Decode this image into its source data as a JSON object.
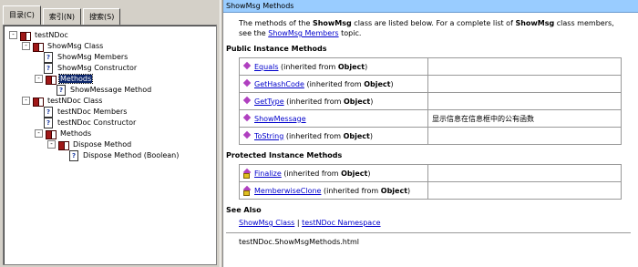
{
  "tabs": [
    "目录(C)",
    "索引(N)",
    "搜索(S)"
  ],
  "tree": [
    {
      "label": "testNDoc",
      "icon": "book",
      "exp": "-",
      "indent": 0
    },
    {
      "label": "ShowMsg Class",
      "icon": "book",
      "exp": "-",
      "indent": 1
    },
    {
      "label": "ShowMsg Members",
      "icon": "page",
      "exp": "",
      "indent": 2
    },
    {
      "label": "ShowMsg Constructor",
      "icon": "page",
      "exp": "",
      "indent": 2
    },
    {
      "label": "Methods",
      "icon": "book",
      "exp": "-",
      "indent": 2,
      "selected": true
    },
    {
      "label": "ShowMessage Method",
      "icon": "page",
      "exp": "",
      "indent": 3
    },
    {
      "label": "testNDoc Class",
      "icon": "book",
      "exp": "-",
      "indent": 1
    },
    {
      "label": "testNDoc Members",
      "icon": "page",
      "exp": "",
      "indent": 2
    },
    {
      "label": "testNDoc Constructor",
      "icon": "page",
      "exp": "",
      "indent": 2
    },
    {
      "label": "Methods",
      "icon": "book",
      "exp": "-",
      "indent": 2
    },
    {
      "label": "Dispose Method",
      "icon": "book",
      "exp": "-",
      "indent": 3
    },
    {
      "label": "Dispose Method (Boolean)",
      "icon": "page",
      "exp": "",
      "indent": 4
    }
  ],
  "header_title": "ShowMsg Methods",
  "intro": {
    "t1": "The methods of the ",
    "b1": "ShowMsg",
    "t2": " class are listed below. For a complete list of ",
    "b2": "ShowMsg",
    "t3": " class members, see the ",
    "link": "ShowMsg Members",
    "t4": " topic."
  },
  "public_heading": "Public Instance Methods",
  "public_methods": [
    {
      "name": "Equals",
      "pre": " (inherited from ",
      "from": "Object",
      "post": ")",
      "desc": ""
    },
    {
      "name": "GetHashCode",
      "pre": " (inherited from ",
      "from": "Object",
      "post": ")",
      "desc": ""
    },
    {
      "name": "GetType",
      "pre": " (inherited from ",
      "from": "Object",
      "post": ")",
      "desc": ""
    },
    {
      "name": "ShowMessage",
      "pre": "",
      "from": "",
      "post": "",
      "desc": "显示信息在信息框中的公有函数"
    },
    {
      "name": "ToString",
      "pre": " (inherited from ",
      "from": "Object",
      "post": ")",
      "desc": ""
    }
  ],
  "protected_heading": "Protected Instance Methods",
  "protected_methods": [
    {
      "name": "Finalize",
      "pre": " (inherited from ",
      "from": "Object",
      "post": ")",
      "desc": ""
    },
    {
      "name": "MemberwiseClone",
      "pre": " (inherited from ",
      "from": "Object",
      "post": ")",
      "desc": ""
    }
  ],
  "see_also_heading": "See Also",
  "see_also": {
    "link1": "ShowMsg Class",
    "sep": " | ",
    "link2": "testNDoc Namespace"
  },
  "footer": "testNDoc.ShowMsgMethods.html",
  "colors": {
    "header_bg": "#99ccff",
    "link": "#0000cc",
    "selection": "#0a246a"
  }
}
